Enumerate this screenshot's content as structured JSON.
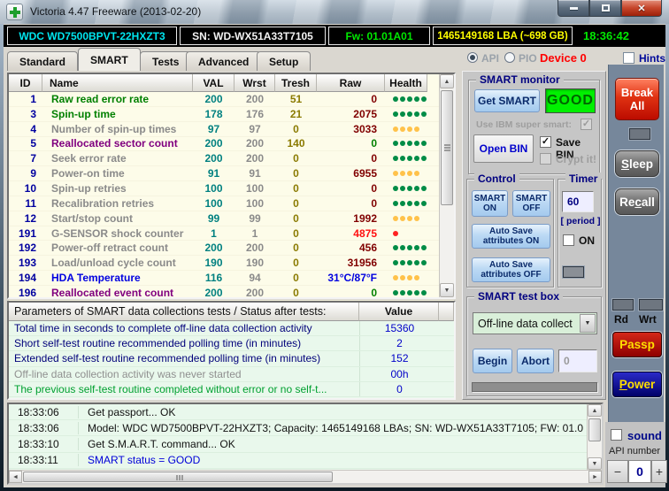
{
  "window": {
    "title": "Victoria 4.47  Freeware (2013-02-20)"
  },
  "info_bar": {
    "model": "WDC WD7500BPVT-22HXZT3",
    "serial": "SN: WD-WX51A33T7105",
    "firmware": "Fw: 01.01A01",
    "capacity": "1465149168 LBA (~698 GB)",
    "clock": "18:36:42"
  },
  "tabs": {
    "items": [
      "Standard",
      "SMART",
      "Tests",
      "Advanced",
      "Setup"
    ],
    "active": "SMART",
    "api_label": "API",
    "pio_label": "PIO",
    "device_label": "Device 0",
    "hints_label": "Hints"
  },
  "smart_table": {
    "headers": [
      "ID",
      "Name",
      "VAL",
      "Wrst",
      "Tresh",
      "Raw",
      "Health"
    ],
    "rows": [
      {
        "id": "1",
        "name": "Raw read error rate",
        "val": "200",
        "wrst": "200",
        "tresh": "51",
        "raw": "0",
        "name_color": "green",
        "raw_color": "maroon",
        "dots": 5,
        "dot_color": "green"
      },
      {
        "id": "3",
        "name": "Spin-up time",
        "val": "178",
        "wrst": "176",
        "tresh": "21",
        "raw": "2075",
        "name_color": "green",
        "raw_color": "maroon",
        "dots": 5,
        "dot_color": "green"
      },
      {
        "id": "4",
        "name": "Number of spin-up times",
        "val": "97",
        "wrst": "97",
        "tresh": "0",
        "raw": "3033",
        "name_color": "gray",
        "raw_color": "maroon",
        "dots": 4,
        "dot_color": "yellow"
      },
      {
        "id": "5",
        "name": "Reallocated sector count",
        "val": "200",
        "wrst": "200",
        "tresh": "140",
        "raw": "0",
        "name_color": "purple",
        "raw_color": "green",
        "dots": 5,
        "dot_color": "green"
      },
      {
        "id": "7",
        "name": "Seek error rate",
        "val": "200",
        "wrst": "200",
        "tresh": "0",
        "raw": "0",
        "name_color": "gray",
        "raw_color": "maroon",
        "dots": 5,
        "dot_color": "green"
      },
      {
        "id": "9",
        "name": "Power-on time",
        "val": "91",
        "wrst": "91",
        "tresh": "0",
        "raw": "6955",
        "name_color": "gray",
        "raw_color": "maroon",
        "dots": 4,
        "dot_color": "yellow"
      },
      {
        "id": "10",
        "name": "Spin-up retries",
        "val": "100",
        "wrst": "100",
        "tresh": "0",
        "raw": "0",
        "name_color": "gray",
        "raw_color": "maroon",
        "dots": 5,
        "dot_color": "green"
      },
      {
        "id": "11",
        "name": "Recalibration retries",
        "val": "100",
        "wrst": "100",
        "tresh": "0",
        "raw": "0",
        "name_color": "gray",
        "raw_color": "maroon",
        "dots": 5,
        "dot_color": "green"
      },
      {
        "id": "12",
        "name": "Start/stop count",
        "val": "99",
        "wrst": "99",
        "tresh": "0",
        "raw": "1992",
        "name_color": "gray",
        "raw_color": "maroon",
        "dots": 4,
        "dot_color": "yellow"
      },
      {
        "id": "191",
        "name": "G-SENSOR shock counter",
        "val": "1",
        "wrst": "1",
        "tresh": "0",
        "raw": "4875",
        "name_color": "gray",
        "raw_color": "red",
        "dots": 1,
        "dot_color": "red"
      },
      {
        "id": "192",
        "name": "Power-off retract count",
        "val": "200",
        "wrst": "200",
        "tresh": "0",
        "raw": "456",
        "name_color": "gray",
        "raw_color": "maroon",
        "dots": 5,
        "dot_color": "green"
      },
      {
        "id": "193",
        "name": "Load/unload cycle count",
        "val": "190",
        "wrst": "190",
        "tresh": "0",
        "raw": "31956",
        "name_color": "gray",
        "raw_color": "maroon",
        "dots": 5,
        "dot_color": "green"
      },
      {
        "id": "194",
        "name": "HDA Temperature",
        "val": "116",
        "wrst": "94",
        "tresh": "0",
        "raw": "31°C/87°F",
        "name_color": "blue",
        "raw_color": "blue",
        "dots": 4,
        "dot_color": "yellow"
      },
      {
        "id": "196",
        "name": "Reallocated event count",
        "val": "200",
        "wrst": "200",
        "tresh": "0",
        "raw": "0",
        "name_color": "purple",
        "raw_color": "green",
        "dots": 5,
        "dot_color": "green"
      }
    ]
  },
  "params_table": {
    "header_label": "Parameters of SMART data collections tests / Status after tests:",
    "header_value": "Value",
    "rows": [
      {
        "label": "Total time in seconds to complete off-line data collection activity",
        "value": "15360",
        "label_color": "navy"
      },
      {
        "label": "Short self-test routine recommended polling time (in minutes)",
        "value": "2",
        "label_color": "navy"
      },
      {
        "label": "Extended self-test routine recommended polling time (in minutes)",
        "value": "152",
        "label_color": "navy"
      },
      {
        "label": "Off-line data collection activity was never started",
        "value": "00h",
        "label_color": "gray"
      },
      {
        "label": "The previous self-test routine completed without error or no self-t...",
        "value": "0",
        "label_color": "green"
      }
    ]
  },
  "log": {
    "entries": [
      {
        "time": "18:33:06",
        "text": "Get passport... OK",
        "color": "black"
      },
      {
        "time": "18:33:06",
        "text": "Model: WDC WD7500BPVT-22HXZT3; Capacity: 1465149168 LBAs; SN: WD-WX51A33T7105; FW: 01.0",
        "color": "black"
      },
      {
        "time": "18:33:10",
        "text": "Get S.M.A.R.T. command... OK",
        "color": "black"
      },
      {
        "time": "18:33:11",
        "text": "SMART status = GOOD",
        "color": "blue"
      }
    ]
  },
  "monitor": {
    "title": "SMART monitor",
    "get_smart": "Get SMART",
    "status": "GOOD",
    "ibm_label": "Use IBM super smart:",
    "open_bin": "Open BIN",
    "save_bin": "Save BIN",
    "crypt": "Crypt it!",
    "check_glyph": "✓"
  },
  "control": {
    "title": "Control",
    "smart_on": "SMART ON",
    "smart_off": "SMART OFF",
    "autosave_on": "Auto Save attributes ON",
    "autosave_off": "Auto Save attributes OFF"
  },
  "timer": {
    "title": "Timer",
    "value": "60",
    "period": "[ period ]",
    "on_label": "ON"
  },
  "testbox": {
    "title": "SMART test box",
    "selected": "Off-line data collect",
    "begin": "Begin",
    "abort": "Abort",
    "counter": "0"
  },
  "side": {
    "break_all": "Break All",
    "sleep": {
      "u": "S",
      "rest": "leep"
    },
    "recall": {
      "pre": "Re",
      "u": "c",
      "rest": "all"
    },
    "rd": "Rd",
    "wrt": "Wrt",
    "passp": "Passp",
    "power": {
      "u": "P",
      "rest": "ower"
    }
  },
  "bottom_right": {
    "sound": "sound",
    "api_number": "API number",
    "spinner": {
      "minus": "−",
      "value": "0",
      "plus": "+"
    }
  },
  "colors": {
    "good_bg": "#00F000",
    "device_red": "#FF0000",
    "model_cyan": "#00E5EE",
    "firmware_green": "#00E800",
    "capacity_yellow": "#FFFF00",
    "clock_green": "#00E800",
    "dots": {
      "green": "#008C46",
      "yellow": "#FFC24A",
      "red": "#FF2222"
    }
  }
}
